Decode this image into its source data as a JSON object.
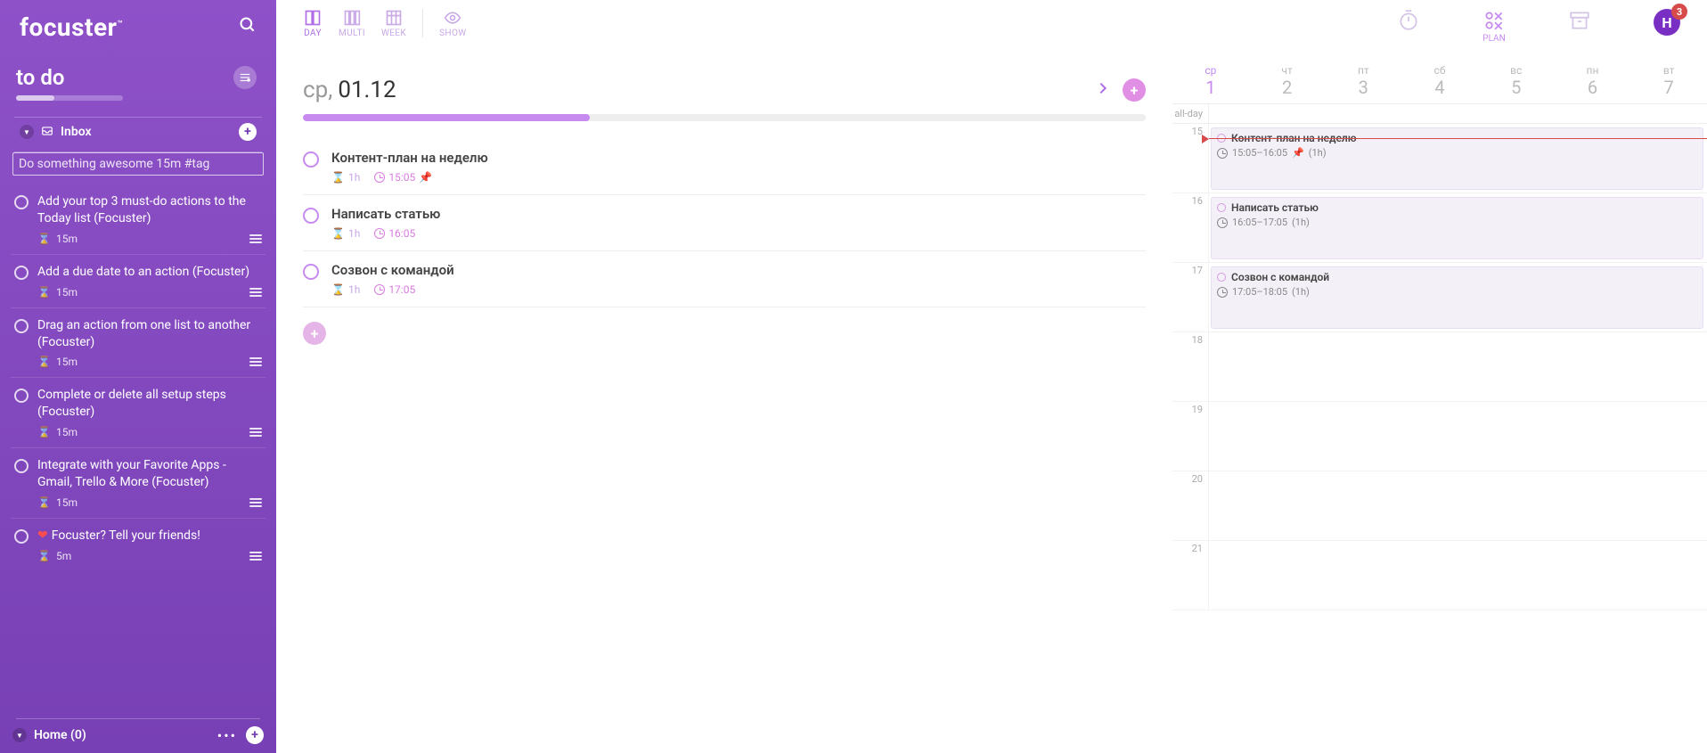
{
  "brand": "focuster",
  "sidebar": {
    "title": "to do",
    "section_inbox": "Inbox",
    "input_placeholder": "Do something awesome 15m #tag",
    "items": [
      {
        "text": "Add your top 3 must-do actions to the Today list (Focuster)",
        "dur": "15m"
      },
      {
        "text": "Add a due date to an action (Focuster)",
        "dur": "15m"
      },
      {
        "text": "Drag an action from one list to another (Focuster)",
        "dur": "15m"
      },
      {
        "text": "Complete or delete all setup steps (Focuster)",
        "dur": "15m"
      },
      {
        "text": "Integrate with your Favorite Apps - Gmail, Trello & More (Focuster)",
        "dur": "15m"
      },
      {
        "text": "Focuster? Tell your friends!",
        "dur": "5m",
        "heart": true
      }
    ],
    "bottom_title": "Home (0)"
  },
  "center": {
    "tabs": {
      "day": "DAY",
      "multi": "MULTI",
      "week": "WEEK",
      "show": "SHOW"
    },
    "date_wd": "ср,",
    "date_num": "01.12",
    "progress_pct": 34,
    "tasks": [
      {
        "title": "Контент-план на неделю",
        "dur": "1h",
        "time": "15:05",
        "pinned": true
      },
      {
        "title": "Написать статью",
        "dur": "1h",
        "time": "16:05"
      },
      {
        "title": "Созвон с командой",
        "dur": "1h",
        "time": "17:05"
      }
    ]
  },
  "right": {
    "buttons": {
      "plan": "PLAN"
    },
    "avatar_letter": "H",
    "badge_count": "3",
    "week": [
      {
        "lbl": "ср",
        "num": "1",
        "today": true
      },
      {
        "lbl": "чт",
        "num": "2"
      },
      {
        "lbl": "пт",
        "num": "3"
      },
      {
        "lbl": "сб",
        "num": "4"
      },
      {
        "lbl": "вс",
        "num": "5"
      },
      {
        "lbl": "пн",
        "num": "6"
      },
      {
        "lbl": "вт",
        "num": "7"
      }
    ],
    "allday_label": "all-day",
    "hours": [
      "15",
      "16",
      "17",
      "18",
      "19",
      "20",
      "21"
    ],
    "events": [
      {
        "title": "Контент-план на неделю",
        "meta": "15:05–16:05",
        "dur": "(1h)",
        "pinned": true
      },
      {
        "title": "Написать статью",
        "meta": "16:05–17:05",
        "dur": "(1h)"
      },
      {
        "title": "Созвон с командой",
        "meta": "17:05–18:05",
        "dur": "(1h)"
      }
    ]
  }
}
